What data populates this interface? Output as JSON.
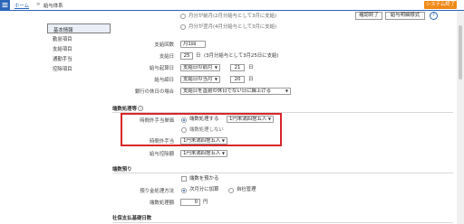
{
  "header": {
    "breadcrumb_home": "ホーム",
    "breadcrumb_sep": ">",
    "breadcrumb_current": "給与体系",
    "exit_button": "システム終了",
    "help_icon_glyph": "?",
    "colors": {
      "accent": "#2b65b8",
      "exit": "#f08a18",
      "highlight": "#d9262b"
    }
  },
  "toolbar": {
    "confirm_button": "確認終了",
    "statement_button": "給与明細様式"
  },
  "sidebar": {
    "items": [
      {
        "label": "基本情報"
      },
      {
        "label": "勤怠項目"
      },
      {
        "label": "支給項目"
      },
      {
        "label": "通勤手当"
      },
      {
        "label": "控除項目"
      }
    ]
  },
  "top_radios": [
    {
      "text": "月分が前月(2月分給与として3月に支給)"
    },
    {
      "text": "月分が翌月(4月分給与として3月に支給)"
    }
  ],
  "payment": {
    "count_label": "支給回数",
    "count_value": "月1回",
    "date_label": "支給日",
    "date_value": "25",
    "date_unit": "日",
    "date_note": "(3月分給与として3月25日に支給)",
    "start_label": "給与起算日",
    "start_select": "支給日の前月",
    "start_day": "21",
    "start_unit": "日",
    "close_label": "給与締日",
    "close_select": "支給日の当月",
    "close_day": "20",
    "close_unit": "日",
    "holiday_label": "銀行の休日の場合",
    "holiday_value": "支給日を直前の休日でない日に繰上げる"
  },
  "rounding": {
    "section_title": "端数処理等",
    "info_icon_glyph": "i",
    "overtime_method_label": "時間外手当単価",
    "opt_process": "端数処理する",
    "opt_process_select": "1円未満四捨五入",
    "opt_noprocess": "端数処理しない",
    "overtime_pay_label": "時間外手当",
    "overtime_pay_value": "1円未満四捨五入",
    "deduction_label": "給与控除額",
    "deduction_value": "1円未満四捨五入"
  },
  "carry": {
    "section_title": "端数預り",
    "deposit_check": "端数を預かる",
    "method_label": "預り金処理方法",
    "opt_next": "次月分に加算",
    "opt_self": "自社管理",
    "amount_label": "端数処理額",
    "amount_value": "0",
    "amount_unit": "円"
  },
  "insurance": {
    "section_title": "社保支払基礎日数"
  }
}
